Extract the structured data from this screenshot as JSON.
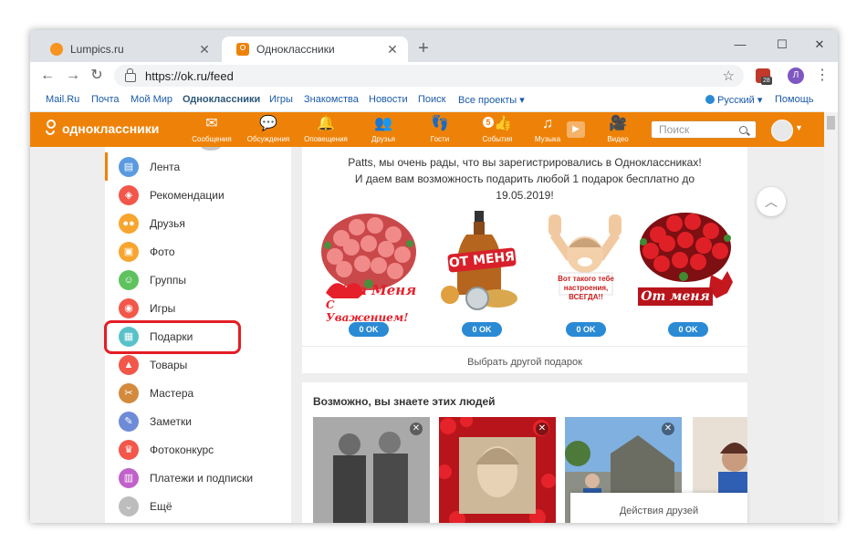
{
  "browser": {
    "tabs": [
      {
        "label": "Lumpics.ru",
        "active": false
      },
      {
        "label": "Одноклассники",
        "active": true
      }
    ],
    "url": "https://ok.ru/feed",
    "extension_badge": "28",
    "profile_letter": "Л"
  },
  "services": {
    "links": [
      "Mail.Ru",
      "Почта",
      "Мой Мир",
      "Одноклассники",
      "Игры",
      "Знакомства",
      "Новости",
      "Поиск",
      "Все проекты ▾"
    ],
    "language": "Русский ▾",
    "help": "Помощь"
  },
  "ok_header": {
    "logo_text": "одноклассники",
    "nav": [
      "Сообщения",
      "Обсуждения",
      "Оповещения",
      "Друзья",
      "Гости",
      "События",
      "Музыка",
      "Видео"
    ],
    "events_badge": "5",
    "search_placeholder": "Поиск"
  },
  "sidebar": {
    "items": [
      {
        "label": "Лента",
        "color": "#5a9be0",
        "icon": "feed-icon"
      },
      {
        "label": "Рекомендации",
        "color": "#f2574a",
        "icon": "compass-icon"
      },
      {
        "label": "Друзья",
        "color": "#f7a52f",
        "icon": "friends-icon"
      },
      {
        "label": "Фото",
        "color": "#f7a52f",
        "icon": "photo-icon"
      },
      {
        "label": "Группы",
        "color": "#5ec25e",
        "icon": "groups-icon"
      },
      {
        "label": "Игры",
        "color": "#f2574a",
        "icon": "games-icon"
      },
      {
        "label": "Подарки",
        "color": "#59c2c9",
        "icon": "gift-icon"
      },
      {
        "label": "Товары",
        "color": "#f2574a",
        "icon": "shopping-bag-icon"
      },
      {
        "label": "Мастера",
        "color": "#d38a3d",
        "icon": "tools-icon"
      },
      {
        "label": "Заметки",
        "color": "#6e8bd8",
        "icon": "pen-icon"
      },
      {
        "label": "Фотоконкурс",
        "color": "#f2574a",
        "icon": "trophy-icon"
      },
      {
        "label": "Платежи и подписки",
        "color": "#c062c9",
        "icon": "wallet-icon"
      },
      {
        "label": "Ещё",
        "color": "#bdbdbd",
        "icon": "chevron-down-icon"
      }
    ]
  },
  "gifts": {
    "promo_lines": [
      "Patts, мы очень рады, что вы зарегистрировались в Одноклассниках!",
      "И даем вам возможность подарить любой 1 подарок бесплатно до",
      "19.05.2019!"
    ],
    "items": [
      {
        "caption_1": "От Меня",
        "caption_2": "С Уважением!",
        "price": "0 OK"
      },
      {
        "caption_1": "ОТ МЕНЯ",
        "caption_2": "",
        "price": "0 OK"
      },
      {
        "caption_1": "Вот такого тебе",
        "caption_2": "настроения, ВСЕГДА!!",
        "price": "0 OK"
      },
      {
        "caption_1": "От меня",
        "caption_2": "",
        "price": "0 OK"
      }
    ],
    "choose_other": "Выбрать другой подарок"
  },
  "people": {
    "title": "Возможно, вы знаете этих людей",
    "friends_actions": "Действия друзей"
  }
}
